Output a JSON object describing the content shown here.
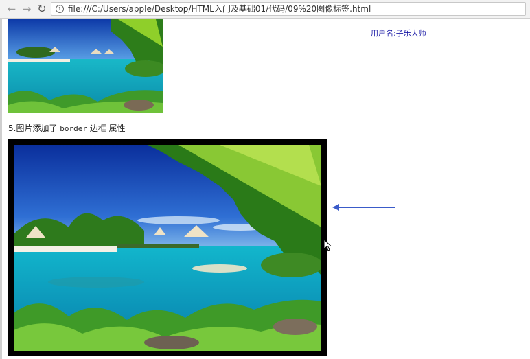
{
  "browser": {
    "back_icon": "back-arrow-icon",
    "forward_icon": "forward-arrow-icon",
    "reload_icon": "reload-icon",
    "info_icon": "info-icon",
    "url": "file:///C:/Users/apple/Desktop/HTML入门及基础01/代码/09%20图像标签.html"
  },
  "page": {
    "user_label": "用户名:子乐大师",
    "heading_prefix": "5.图片添加了 ",
    "heading_code": "border",
    "heading_suffix": " 边框 属性"
  },
  "images": {
    "small": "tropical-lagoon-photo",
    "big": "tropical-lagoon-photo-with-border"
  },
  "annotation": {
    "arrow_color": "#3a5bc9"
  }
}
